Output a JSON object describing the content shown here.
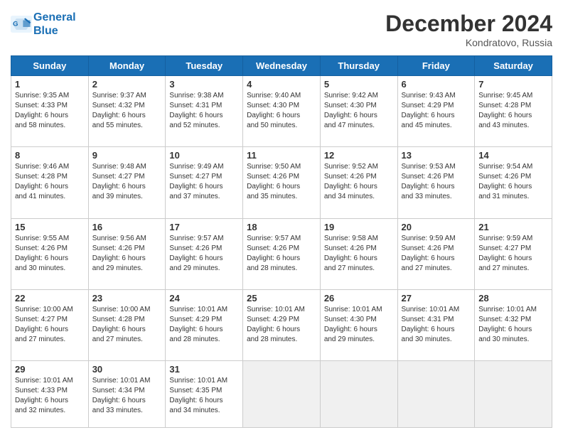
{
  "header": {
    "logo_line1": "General",
    "logo_line2": "Blue",
    "month": "December 2024",
    "location": "Kondratovo, Russia"
  },
  "weekdays": [
    "Sunday",
    "Monday",
    "Tuesday",
    "Wednesday",
    "Thursday",
    "Friday",
    "Saturday"
  ],
  "weeks": [
    [
      {
        "day": "1",
        "sunrise": "9:35 AM",
        "sunset": "4:33 PM",
        "daylight": "6 hours and 58 minutes."
      },
      {
        "day": "2",
        "sunrise": "9:37 AM",
        "sunset": "4:32 PM",
        "daylight": "6 hours and 55 minutes."
      },
      {
        "day": "3",
        "sunrise": "9:38 AM",
        "sunset": "4:31 PM",
        "daylight": "6 hours and 52 minutes."
      },
      {
        "day": "4",
        "sunrise": "9:40 AM",
        "sunset": "4:30 PM",
        "daylight": "6 hours and 50 minutes."
      },
      {
        "day": "5",
        "sunrise": "9:42 AM",
        "sunset": "4:30 PM",
        "daylight": "6 hours and 47 minutes."
      },
      {
        "day": "6",
        "sunrise": "9:43 AM",
        "sunset": "4:29 PM",
        "daylight": "6 hours and 45 minutes."
      },
      {
        "day": "7",
        "sunrise": "9:45 AM",
        "sunset": "4:28 PM",
        "daylight": "6 hours and 43 minutes."
      }
    ],
    [
      {
        "day": "8",
        "sunrise": "9:46 AM",
        "sunset": "4:28 PM",
        "daylight": "6 hours and 41 minutes."
      },
      {
        "day": "9",
        "sunrise": "9:48 AM",
        "sunset": "4:27 PM",
        "daylight": "6 hours and 39 minutes."
      },
      {
        "day": "10",
        "sunrise": "9:49 AM",
        "sunset": "4:27 PM",
        "daylight": "6 hours and 37 minutes."
      },
      {
        "day": "11",
        "sunrise": "9:50 AM",
        "sunset": "4:26 PM",
        "daylight": "6 hours and 35 minutes."
      },
      {
        "day": "12",
        "sunrise": "9:52 AM",
        "sunset": "4:26 PM",
        "daylight": "6 hours and 34 minutes."
      },
      {
        "day": "13",
        "sunrise": "9:53 AM",
        "sunset": "4:26 PM",
        "daylight": "6 hours and 33 minutes."
      },
      {
        "day": "14",
        "sunrise": "9:54 AM",
        "sunset": "4:26 PM",
        "daylight": "6 hours and 31 minutes."
      }
    ],
    [
      {
        "day": "15",
        "sunrise": "9:55 AM",
        "sunset": "4:26 PM",
        "daylight": "6 hours and 30 minutes."
      },
      {
        "day": "16",
        "sunrise": "9:56 AM",
        "sunset": "4:26 PM",
        "daylight": "6 hours and 29 minutes."
      },
      {
        "day": "17",
        "sunrise": "9:57 AM",
        "sunset": "4:26 PM",
        "daylight": "6 hours and 29 minutes."
      },
      {
        "day": "18",
        "sunrise": "9:57 AM",
        "sunset": "4:26 PM",
        "daylight": "6 hours and 28 minutes."
      },
      {
        "day": "19",
        "sunrise": "9:58 AM",
        "sunset": "4:26 PM",
        "daylight": "6 hours and 27 minutes."
      },
      {
        "day": "20",
        "sunrise": "9:59 AM",
        "sunset": "4:26 PM",
        "daylight": "6 hours and 27 minutes."
      },
      {
        "day": "21",
        "sunrise": "9:59 AM",
        "sunset": "4:27 PM",
        "daylight": "6 hours and 27 minutes."
      }
    ],
    [
      {
        "day": "22",
        "sunrise": "10:00 AM",
        "sunset": "4:27 PM",
        "daylight": "6 hours and 27 minutes."
      },
      {
        "day": "23",
        "sunrise": "10:00 AM",
        "sunset": "4:28 PM",
        "daylight": "6 hours and 27 minutes."
      },
      {
        "day": "24",
        "sunrise": "10:01 AM",
        "sunset": "4:29 PM",
        "daylight": "6 hours and 28 minutes."
      },
      {
        "day": "25",
        "sunrise": "10:01 AM",
        "sunset": "4:29 PM",
        "daylight": "6 hours and 28 minutes."
      },
      {
        "day": "26",
        "sunrise": "10:01 AM",
        "sunset": "4:30 PM",
        "daylight": "6 hours and 29 minutes."
      },
      {
        "day": "27",
        "sunrise": "10:01 AM",
        "sunset": "4:31 PM",
        "daylight": "6 hours and 30 minutes."
      },
      {
        "day": "28",
        "sunrise": "10:01 AM",
        "sunset": "4:32 PM",
        "daylight": "6 hours and 30 minutes."
      }
    ],
    [
      {
        "day": "29",
        "sunrise": "10:01 AM",
        "sunset": "4:33 PM",
        "daylight": "6 hours and 32 minutes."
      },
      {
        "day": "30",
        "sunrise": "10:01 AM",
        "sunset": "4:34 PM",
        "daylight": "6 hours and 33 minutes."
      },
      {
        "day": "31",
        "sunrise": "10:01 AM",
        "sunset": "4:35 PM",
        "daylight": "6 hours and 34 minutes."
      },
      null,
      null,
      null,
      null
    ]
  ]
}
